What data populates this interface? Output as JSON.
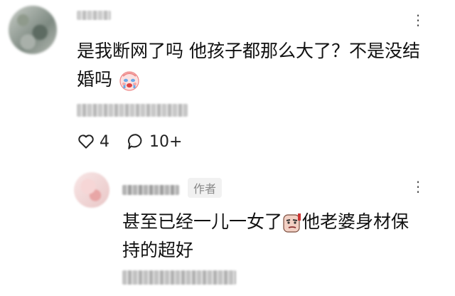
{
  "comment": {
    "text_line1": "是我断网了吗 他孩子都那么大了？不是没结",
    "text_line2": "婚吗",
    "emoji": "crying-face",
    "likes": "4",
    "replies": "10+",
    "icons": {
      "like": "heart-outline-icon",
      "reply": "speech-bubble-icon",
      "more": "more-dots-icon"
    }
  },
  "reply": {
    "author_tag": "作者",
    "text_line1": "甚至已经一儿一女了",
    "text_line1_b": "他老婆身材保",
    "text_line2": "持的超好",
    "emoji": "smirk-face"
  },
  "colors": {
    "text": "#111111",
    "muted": "#888888",
    "tag_bg": "#f1f1f1"
  }
}
